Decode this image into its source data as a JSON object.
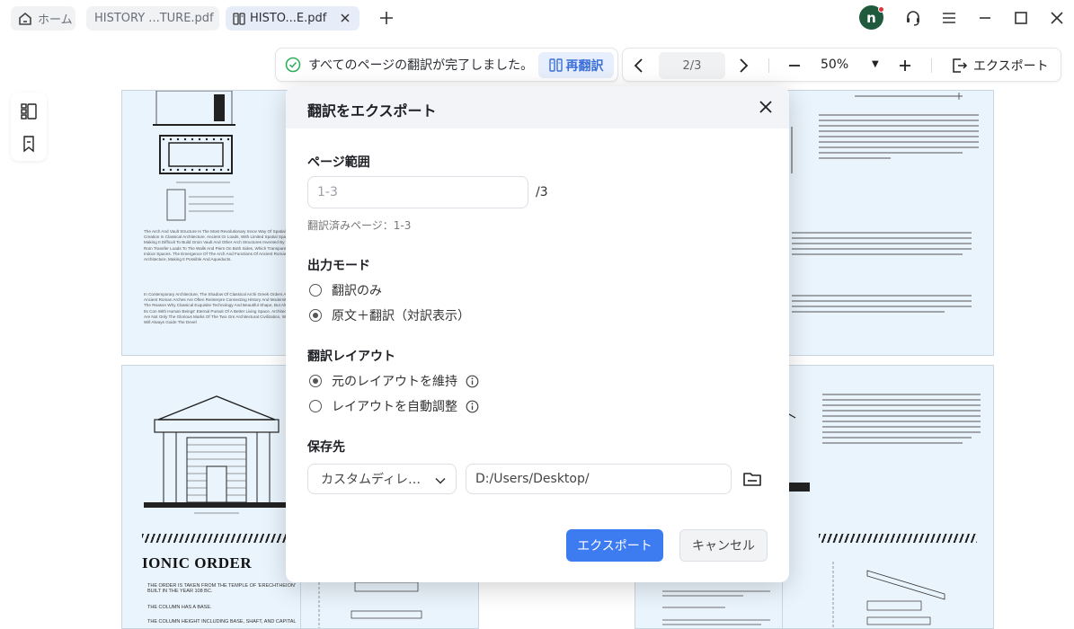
{
  "tabs": {
    "home_label": "ホーム",
    "doc1_label": "HISTORY ...TURE.pdf",
    "doc2_label": "HISTO...E.pdf"
  },
  "user": {
    "avatar_initial": "n"
  },
  "toolbar": {
    "notice_text": "すべてのページの翻訳が完了しました。",
    "retranslate_label": "再翻訳",
    "page_indicator": "2/3",
    "zoom_level": "50%",
    "export_label": "エクスポート"
  },
  "document": {
    "ionic_heading": "IONIC ORDER",
    "page1_text": "The Arch And Vault Structure Is The Most Revolutionary Innov Way Of Spatial Creation In Classical Architecture. Ancient Gr Loads, With Limited Spatial Span, Making It Difficult To Build Groin Vault And Other Arch Structures Invented By The Rom Transfer Loads To The Walls And Piers On Both Sides, Which Transparent Indoor Spaces. The Emergence Of The Arch And Functions Of Ancient Roman Architecture, Making It Possible And Aqueducts.",
    "page1_text2": "In Contemporary Architecture, The Shadow Of Classical Archi Greek Orders And Ancient Roman Arches Are Often Reinterpre Connecting History And Modernity. The Reason Why Classical Exquisite Technology And Beautiful Shape, But Also In Its Con With Human Beings' Eternal Pursuit Of A Better Living Space. Architecture Are Not Only The Glorious Marks Of The Two Gre Architectural Civilization, Which Will Always Guide The Devel",
    "page3_notes": [
      "THE ORDER IS TAKEN FROM THE TEMPLE OF 'ERECHTHEION' BUILT IN THE YEAR 108 BC.",
      "THE COLUMN HAS A BASE.",
      "THE COLUMN HEIGHT INCLUDING BASE, SHAFT, AND CAPITAL"
    ]
  },
  "dialog": {
    "title": "翻訳をエクスポート",
    "page_range": {
      "title": "ページ範囲",
      "placeholder": "1-3",
      "total": "/3",
      "note": "翻訳済みページ：1-3"
    },
    "output_mode": {
      "title": "出力モード",
      "options": [
        {
          "label": "翻訳のみ",
          "selected": false
        },
        {
          "label": "原文＋翻訳（対訳表示）",
          "selected": true
        }
      ]
    },
    "layout": {
      "title": "翻訳レイアウト",
      "options": [
        {
          "label": "元のレイアウトを維持",
          "selected": true
        },
        {
          "label": "レイアウトを自動調整",
          "selected": false
        }
      ]
    },
    "destination": {
      "title": "保存先",
      "select_value": "カスタムディレ…",
      "path_value": "D:/Users/Desktop/"
    },
    "export_button": "エクスポート",
    "cancel_button": "キャンセル"
  },
  "colors": {
    "accent": "#3d7bf0",
    "success": "#2fae5c",
    "page_bg": "#eaf4fc",
    "avatar_bg": "#1f5a3d"
  }
}
